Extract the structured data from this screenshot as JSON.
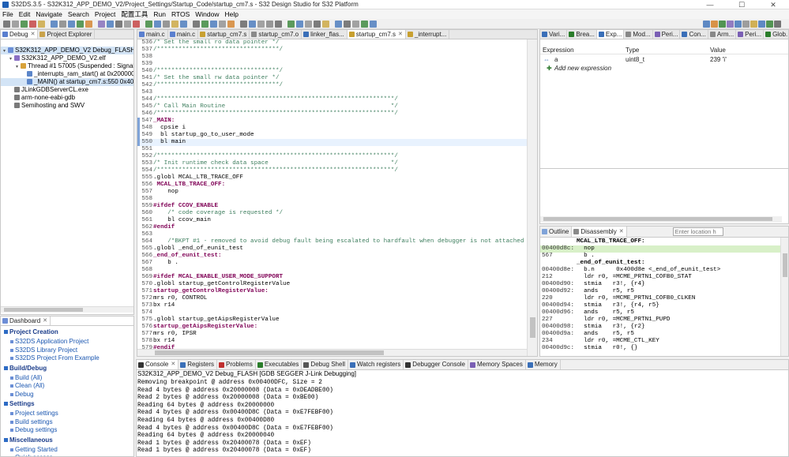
{
  "window": {
    "title": "S32DS.3.5 - S32K312_APP_DEMO_V2/Project_Settings/Startup_Code/startup_cm7.s - S32 Design Studio for S32 Platform",
    "minimize": "—",
    "maximize": "☐",
    "close": "✕"
  },
  "menu": [
    "File",
    "Edit",
    "Navigate",
    "Search",
    "Project",
    "配置工具",
    "Run",
    "RTOS",
    "Window",
    "Help"
  ],
  "left_top": {
    "tabs": [
      {
        "label": "Debug",
        "active": true
      },
      {
        "label": "Project Explorer",
        "active": false
      }
    ],
    "tree": [
      {
        "label": "S32K312_APP_DEMO_V2 Debug_FLASH [GDB SEGGER J-Link Debugging]",
        "indent": 0,
        "twisty": "▾",
        "icon": "#6b8fd6",
        "selected": true
      },
      {
        "label": "S32K312_APP_DEMO_V2.elf",
        "indent": 1,
        "twisty": "▾",
        "icon": "#8a6fc4",
        "selected": false
      },
      {
        "label": "Thread #1 57005 (Suspended : Signal : SIGTRAP:Trace/breakpoint trap)",
        "indent": 2,
        "twisty": "▾",
        "icon": "#d8a23a",
        "selected": false
      },
      {
        "label": "_interrupts_ram_start() at 0x20000000",
        "indent": 3,
        "twisty": "",
        "icon": "#5c86c9",
        "selected": false
      },
      {
        "label": "_MAIN() at startup_cm7.s:550 0x400c",
        "indent": 3,
        "twisty": "",
        "icon": "#5c86c9",
        "selected": true
      },
      {
        "label": "JLinkGDBServerCL.exe",
        "indent": 1,
        "twisty": "",
        "icon": "#7a7a7a",
        "selected": false
      },
      {
        "label": "arm-none-eabi-gdb",
        "indent": 1,
        "twisty": "",
        "icon": "#7a7a7a",
        "selected": false
      },
      {
        "label": "Semihosting and SWV",
        "indent": 1,
        "twisty": "",
        "icon": "#7a7a7a",
        "selected": false
      }
    ]
  },
  "dashboard": {
    "tab": "Dashboard",
    "sections": [
      {
        "heading": "Project Creation",
        "items": [
          "S32DS Application Project",
          "S32DS Library Project",
          "S32DS Project From Example"
        ]
      },
      {
        "heading": "Build/Debug",
        "items": [
          "Build  (All)",
          "Clean  (All)",
          "Debug"
        ]
      },
      {
        "heading": "Settings",
        "items": [
          "Project settings",
          "Build settings",
          "Debug settings"
        ]
      },
      {
        "heading": "Miscellaneous",
        "items": [
          "Getting Started",
          "Quick access"
        ]
      }
    ]
  },
  "editor": {
    "tabs": [
      {
        "label": "main.c",
        "active": false
      },
      {
        "label": "main.c",
        "active": false
      },
      {
        "label": "startup_cm7.s",
        "active": false
      },
      {
        "label": "startup_cm7.o",
        "active": false
      },
      {
        "label": "linker_flas...",
        "active": false
      },
      {
        "label": "startup_cm7.s",
        "active": true
      },
      {
        "label": "_interrupt...",
        "active": false
      }
    ],
    "current_line": "550",
    "lines": [
      {
        "n": "536",
        "k": "cm",
        "t": "/* Set the small ro data pointer */"
      },
      {
        "n": "537",
        "k": "cm",
        "t": "/**********************************/"
      },
      {
        "n": "538",
        "k": "tx",
        "t": ""
      },
      {
        "n": "539",
        "k": "tx",
        "t": ""
      },
      {
        "n": "540",
        "k": "cm",
        "t": "/**********************************/"
      },
      {
        "n": "541",
        "k": "cm",
        "t": "/* Set the small rw data pointer */"
      },
      {
        "n": "542",
        "k": "cm",
        "t": "/**********************************/"
      },
      {
        "n": "543",
        "k": "tx",
        "t": ""
      },
      {
        "n": "544",
        "k": "cm",
        "t": "/******************************************************************/"
      },
      {
        "n": "545",
        "k": "cm",
        "t": "/* Call Main Routine                                              */"
      },
      {
        "n": "546",
        "k": "cm",
        "t": "/******************************************************************/"
      },
      {
        "n": "547",
        "k": "lb",
        "t": "_MAIN:"
      },
      {
        "n": "548",
        "k": "tx",
        "t": "  cpsie i"
      },
      {
        "n": "549",
        "k": "tx",
        "t": "  bl startup_go_to_user_mode"
      },
      {
        "n": "550",
        "k": "tx",
        "t": "  bl main"
      },
      {
        "n": "551",
        "k": "tx",
        "t": ""
      },
      {
        "n": "552",
        "k": "cm",
        "t": "/******************************************************************/"
      },
      {
        "n": "553",
        "k": "cm",
        "t": "/* Init runtime check data space                                  */"
      },
      {
        "n": "554",
        "k": "cm",
        "t": "/******************************************************************/"
      },
      {
        "n": "555",
        "k": "tx",
        "t": ".globl MCAL_LTB_TRACE_OFF"
      },
      {
        "n": "556",
        "k": "lb",
        "t": " MCAL_LTB_TRACE_OFF:"
      },
      {
        "n": "557",
        "k": "tx",
        "t": "    nop"
      },
      {
        "n": "558",
        "k": "tx",
        "t": ""
      },
      {
        "n": "559",
        "k": "di",
        "t": "#ifdef CCOV_ENABLE"
      },
      {
        "n": "560",
        "k": "cm",
        "t": "    /* code coverage is requested */"
      },
      {
        "n": "561",
        "k": "tx",
        "t": "    bl ccov_main"
      },
      {
        "n": "562",
        "k": "di",
        "t": "#endif"
      },
      {
        "n": "563",
        "k": "tx",
        "t": ""
      },
      {
        "n": "564",
        "k": "cm",
        "t": "    /*BKPT #1 - removed to avoid debug fault being escalated to hardfault when debugger is not attached or on"
      },
      {
        "n": "565",
        "k": "tx",
        "t": ".globl _end_of_eunit_test"
      },
      {
        "n": "566",
        "k": "lb",
        "t": "_end_of_eunit_test:"
      },
      {
        "n": "567",
        "k": "tx",
        "t": "    b ."
      },
      {
        "n": "568",
        "k": "tx",
        "t": ""
      },
      {
        "n": "569",
        "k": "di",
        "t": "#ifdef MCAL_ENABLE_USER_MODE_SUPPORT"
      },
      {
        "n": "570",
        "k": "tx",
        "t": ".globl startup_getControlRegisterValue"
      },
      {
        "n": "571",
        "k": "lb",
        "t": "startup_getControlRegisterValue:"
      },
      {
        "n": "572",
        "k": "tx",
        "t": "mrs r0, CONTROL"
      },
      {
        "n": "573",
        "k": "tx",
        "t": "bx r14"
      },
      {
        "n": "574",
        "k": "tx",
        "t": ""
      },
      {
        "n": "575",
        "k": "tx",
        "t": ".globl startup_getAipsRegisterValue"
      },
      {
        "n": "576",
        "k": "lb",
        "t": "startup_getAipsRegisterValue:"
      },
      {
        "n": "577",
        "k": "tx",
        "t": "mrs r0, IPSR"
      },
      {
        "n": "578",
        "k": "tx",
        "t": "bx r14"
      },
      {
        "n": "579",
        "k": "di",
        "t": "#endif"
      }
    ]
  },
  "right_top": {
    "tabs": [
      {
        "label": "Vari...",
        "active": false
      },
      {
        "label": "Brea...",
        "active": false
      },
      {
        "label": "Exp...",
        "active": true
      },
      {
        "label": "Mod...",
        "active": false
      },
      {
        "label": "Peri...",
        "active": false
      },
      {
        "label": "Con...",
        "active": false
      },
      {
        "label": "Arm...",
        "active": false
      },
      {
        "label": "Peri...",
        "active": false
      },
      {
        "label": "Glob...",
        "active": false
      }
    ],
    "columns": [
      "Expression",
      "Type",
      "Value"
    ],
    "rows": [
      {
        "expr": "a",
        "type": "uint8_t",
        "value": "239 'ï'"
      }
    ],
    "add_new": "Add new expression",
    "detail_columns": [
      "Expression",
      "Type"
    ]
  },
  "disasm": {
    "tabs": [
      {
        "label": "Outline",
        "active": false
      },
      {
        "label": "Disassembly",
        "active": true
      }
    ],
    "location_placeholder": "Enter location h",
    "lines": [
      {
        "addr": "",
        "text": "MCAL_LTB_TRACE_OFF:",
        "bold": true,
        "hl": false
      },
      {
        "addr": "00400d8c:",
        "text": "  nop",
        "bold": false,
        "hl": true
      },
      {
        "addr": "567",
        "text": "  b .",
        "bold": false,
        "hl": false
      },
      {
        "addr": "",
        "text": "_end_of_eunit_test:",
        "bold": true,
        "hl": false
      },
      {
        "addr": "00400d8e:",
        "text": "  b.n      0x400d8e <_end_of_eunit_test>",
        "bold": false,
        "hl": false
      },
      {
        "addr": "212",
        "text": "  ldr r0, =MCME_PRTN1_COFB0_STAT",
        "bold": false,
        "hl": false
      },
      {
        "addr": "00400d90:",
        "text": "  stmia   r3!, {r4}",
        "bold": false,
        "hl": false
      },
      {
        "addr": "00400d92:",
        "text": "  ands    r5, r5",
        "bold": false,
        "hl": false
      },
      {
        "addr": "220",
        "text": "  ldr r0, =MCME_PRTN1_COFB0_CLKEN",
        "bold": false,
        "hl": false
      },
      {
        "addr": "00400d94:",
        "text": "  stmia   r3!, {r4, r5}",
        "bold": false,
        "hl": false
      },
      {
        "addr": "00400d96:",
        "text": "  ands    r5, r5",
        "bold": false,
        "hl": false
      },
      {
        "addr": "227",
        "text": "  ldr r0, =MCME_PRTN1_PUPD",
        "bold": false,
        "hl": false
      },
      {
        "addr": "00400d98:",
        "text": "  stmia   r3!, {r2}",
        "bold": false,
        "hl": false
      },
      {
        "addr": "00400d9a:",
        "text": "  ands    r5, r5",
        "bold": false,
        "hl": false
      },
      {
        "addr": "234",
        "text": "  ldr r0, =MCME_CTL_KEY",
        "bold": false,
        "hl": false
      },
      {
        "addr": "00400d9c:",
        "text": "  stmia   r0!, {}",
        "bold": false,
        "hl": false
      }
    ]
  },
  "console": {
    "tabs": [
      {
        "label": "Console",
        "active": true
      },
      {
        "label": "Registers",
        "active": false
      },
      {
        "label": "Problems",
        "active": false
      },
      {
        "label": "Executables",
        "active": false
      },
      {
        "label": "Debug Shell",
        "active": false
      },
      {
        "label": "Watch registers",
        "active": false
      },
      {
        "label": "Debugger Console",
        "active": false
      },
      {
        "label": "Memory Spaces",
        "active": false
      },
      {
        "label": "Memory",
        "active": false
      }
    ],
    "header": "S32K312_APP_DEMO_V2 Debug_FLASH [GDB SEGGER J-Link Debugging]",
    "lines": [
      "Removing breakpoint @ address 0x00400DFC, Size = 2",
      "Read 4 bytes @ address 0x20000008 (Data = 0xDEADBE00)",
      "Read 2 bytes @ address 0x20000008 (Data = 0xBE00)",
      "Reading 64 bytes @ address 0x20000000",
      "Read 4 bytes @ address 0x00400D8C (Data = 0xE7FEBF00)",
      "Reading 64 bytes @ address 0x00400D80",
      "Read 4 bytes @ address 0x00400D8C (Data = 0xE7FEBF00)",
      "Reading 64 bytes @ address 0x20000040",
      "Read 1 bytes @ address 0x20400078 (Data = 0xEF)",
      "Read 1 bytes @ address 0x20400078 (Data = 0xEF)"
    ]
  },
  "colors": {
    "accent": "#1a56b0",
    "selection": "#d3e4f6",
    "current_line": "#e8f2fe",
    "comment": "#3f7f5f",
    "keyword": "#7f0055"
  }
}
